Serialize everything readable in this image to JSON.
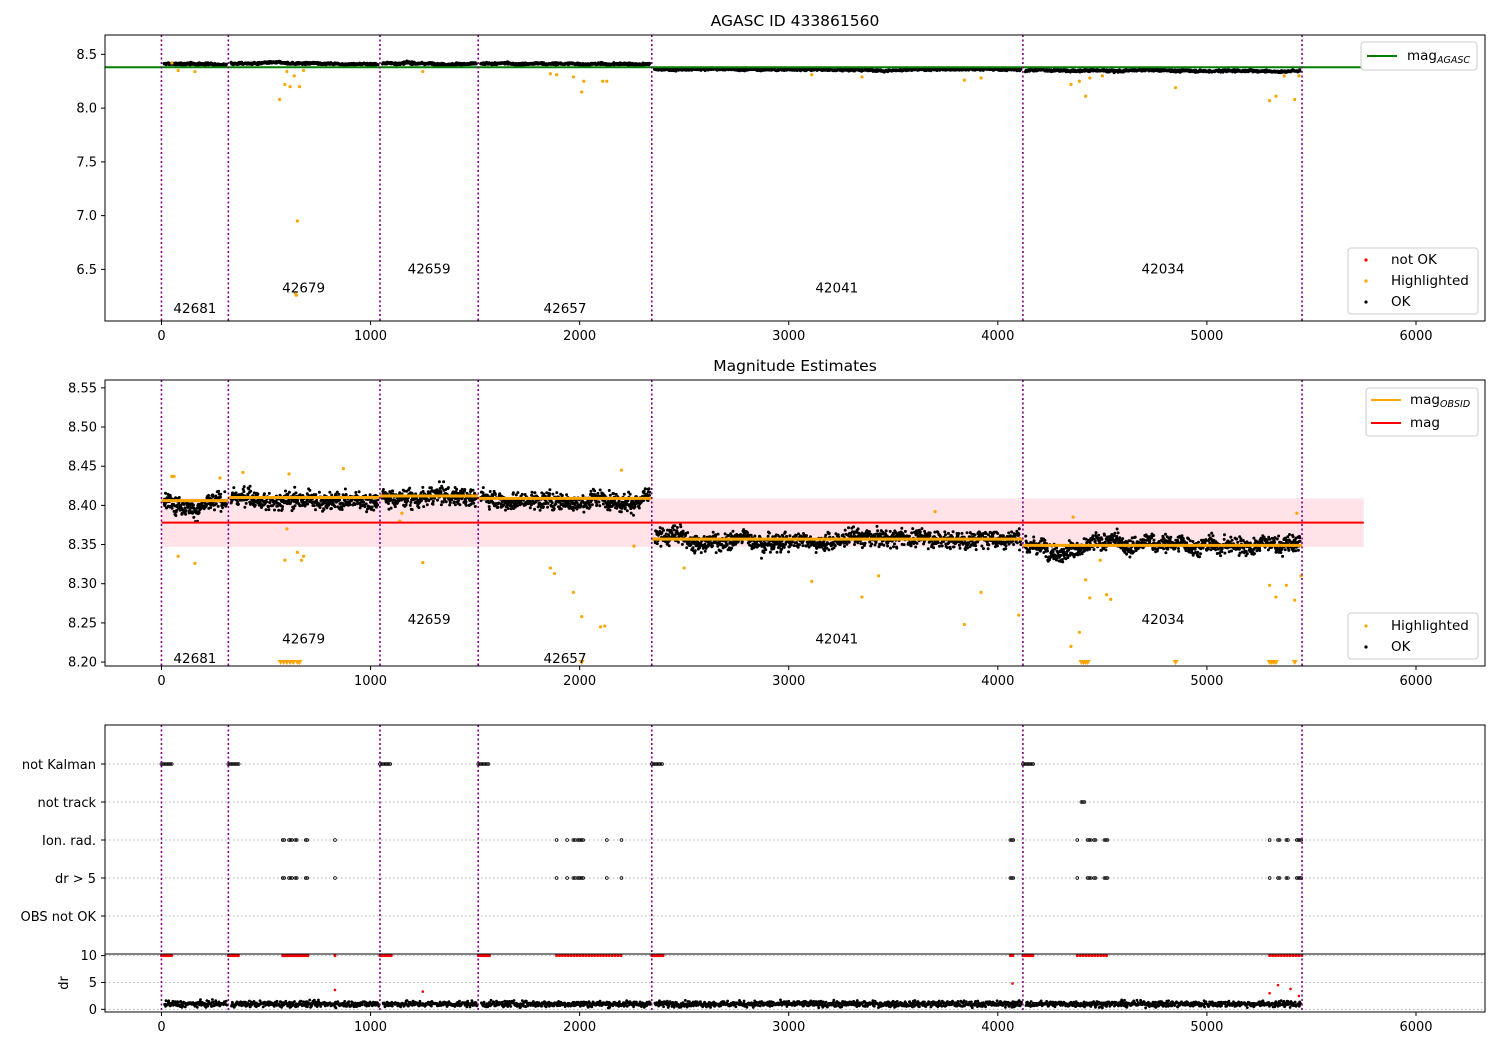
{
  "colors": {
    "ok": "#000000",
    "highlighted": "#ffa500",
    "not_ok": "#ff0000",
    "mag_agasc": "#008000",
    "mag_obsid": "#ffa500",
    "mag": "#ff0000",
    "mag_band": "#ffc0cb",
    "obsid_divider": "#800080"
  },
  "chart_data": [
    {
      "type": "scatter",
      "title": "AGASC ID 433861560",
      "xlabel": "",
      "ylabel": "",
      "xlim": [
        -270,
        6330
      ],
      "ylim": [
        6.02,
        8.68
      ],
      "x_ticks": [
        "0",
        "1000",
        "2000",
        "3000",
        "4000",
        "5000",
        "6000"
      ],
      "y_ticks": [
        "6.5",
        "7.0",
        "7.5",
        "8.0",
        "8.5"
      ],
      "grid": false,
      "obsid_boundaries": [
        0,
        320,
        1045,
        1515,
        2345,
        4120,
        5455
      ],
      "obsid_labels": [
        {
          "obsid": "42681",
          "x": 160,
          "y": 6.14
        },
        {
          "obsid": "42679",
          "x": 680,
          "y": 6.33
        },
        {
          "obsid": "42659",
          "x": 1280,
          "y": 6.51
        },
        {
          "obsid": "42657",
          "x": 1930,
          "y": 6.14
        },
        {
          "obsid": "42041",
          "x": 3230,
          "y": 6.33
        },
        {
          "obsid": "42034",
          "x": 4790,
          "y": 6.51
        }
      ],
      "mag_agasc": 8.38,
      "segments": [
        {
          "x_start": 0,
          "x_end": 320,
          "mean": 8.41,
          "spread": 0.012
        },
        {
          "x_start": 320,
          "x_end": 1045,
          "mean": 8.415,
          "spread": 0.012
        },
        {
          "x_start": 1045,
          "x_end": 1515,
          "mean": 8.415,
          "spread": 0.012
        },
        {
          "x_start": 1515,
          "x_end": 2345,
          "mean": 8.41,
          "spread": 0.012
        },
        {
          "x_start": 2345,
          "x_end": 4120,
          "mean": 8.36,
          "spread": 0.012
        },
        {
          "x_start": 4120,
          "x_end": 5455,
          "mean": 8.35,
          "spread": 0.012
        }
      ],
      "highlighted_points": [
        [
          50,
          8.42
        ],
        [
          80,
          8.35
        ],
        [
          160,
          8.34
        ],
        [
          565,
          8.08
        ],
        [
          590,
          8.22
        ],
        [
          600,
          8.34
        ],
        [
          615,
          8.2
        ],
        [
          635,
          8.3
        ],
        [
          640,
          6.28
        ],
        [
          645,
          6.26
        ],
        [
          650,
          6.95
        ],
        [
          660,
          8.2
        ],
        [
          680,
          8.35
        ],
        [
          1250,
          8.34
        ],
        [
          1860,
          8.32
        ],
        [
          1890,
          8.31
        ],
        [
          1970,
          8.29
        ],
        [
          2010,
          8.15
        ],
        [
          2020,
          8.25
        ],
        [
          2110,
          8.25
        ],
        [
          2130,
          8.25
        ],
        [
          3110,
          8.31
        ],
        [
          3350,
          8.29
        ],
        [
          3840,
          8.26
        ],
        [
          3920,
          8.28
        ],
        [
          4350,
          8.22
        ],
        [
          4390,
          8.25
        ],
        [
          4420,
          8.11
        ],
        [
          4440,
          8.28
        ],
        [
          4500,
          8.3
        ],
        [
          4850,
          8.19
        ],
        [
          5300,
          8.07
        ],
        [
          5330,
          8.11
        ],
        [
          5370,
          8.3
        ],
        [
          5420,
          8.08
        ],
        [
          5440,
          8.3
        ]
      ],
      "series": [
        {
          "name": "not OK",
          "marker": "dot"
        },
        {
          "name": "Highlighted",
          "marker": "dot"
        },
        {
          "name": "OK",
          "marker": "dot"
        }
      ],
      "legend_lines": [
        {
          "name": "mag",
          "subscript": "AGASC"
        }
      ],
      "legend_placement": "top-right (line), bottom-right (points)"
    },
    {
      "type": "scatter",
      "title": "Magnitude Estimates",
      "xlabel": "",
      "ylabel": "",
      "xlim": [
        -270,
        6330
      ],
      "ylim": [
        8.195,
        8.56
      ],
      "x_ticks": [
        "0",
        "1000",
        "2000",
        "3000",
        "4000",
        "5000",
        "6000"
      ],
      "y_ticks": [
        "8.20",
        "8.25",
        "8.30",
        "8.35",
        "8.40",
        "8.45",
        "8.50",
        "8.55"
      ],
      "grid": false,
      "obsid_labels": [
        {
          "obsid": "42681",
          "x": 160,
          "y": 8.205
        },
        {
          "obsid": "42679",
          "x": 680,
          "y": 8.23
        },
        {
          "obsid": "42659",
          "x": 1280,
          "y": 8.255
        },
        {
          "obsid": "42657",
          "x": 1930,
          "y": 8.205
        },
        {
          "obsid": "42041",
          "x": 3230,
          "y": 8.23
        },
        {
          "obsid": "42034",
          "x": 4790,
          "y": 8.255
        }
      ],
      "mag": 8.378,
      "mag_band": [
        8.347,
        8.409
      ],
      "mag_x_range": [
        0,
        5750
      ],
      "mag_obsid": [
        {
          "x_start": 0,
          "x_end": 320,
          "value": 8.406
        },
        {
          "x_start": 320,
          "x_end": 1045,
          "value": 8.41
        },
        {
          "x_start": 1045,
          "x_end": 1515,
          "value": 8.412
        },
        {
          "x_start": 1515,
          "x_end": 2345,
          "value": 8.409
        },
        {
          "x_start": 2345,
          "x_end": 4120,
          "value": 8.357
        },
        {
          "x_start": 4120,
          "x_end": 5455,
          "value": 8.349
        }
      ],
      "segments": [
        {
          "x_start": 0,
          "x_end": 320,
          "mean": 8.403,
          "spread": 0.012
        },
        {
          "x_start": 320,
          "x_end": 1045,
          "mean": 8.41,
          "spread": 0.013
        },
        {
          "x_start": 1045,
          "x_end": 1515,
          "mean": 8.412,
          "spread": 0.012
        },
        {
          "x_start": 1515,
          "x_end": 2345,
          "mean": 8.41,
          "spread": 0.012
        },
        {
          "x_start": 2345,
          "x_end": 4120,
          "mean": 8.358,
          "spread": 0.012
        },
        {
          "x_start": 4120,
          "x_end": 5455,
          "mean": 8.349,
          "spread": 0.012
        }
      ],
      "highlighted_points": [
        [
          50,
          8.437
        ],
        [
          60,
          8.437
        ],
        [
          80,
          8.335
        ],
        [
          160,
          8.326
        ],
        [
          280,
          8.435
        ],
        [
          390,
          8.442
        ],
        [
          590,
          8.33
        ],
        [
          600,
          8.37
        ],
        [
          610,
          8.44
        ],
        [
          650,
          8.34
        ],
        [
          670,
          8.33
        ],
        [
          680,
          8.335
        ],
        [
          870,
          8.447
        ],
        [
          1140,
          8.38
        ],
        [
          1150,
          8.39
        ],
        [
          1250,
          8.327
        ],
        [
          1860,
          8.32
        ],
        [
          1880,
          8.313
        ],
        [
          1970,
          8.289
        ],
        [
          2010,
          8.258
        ],
        [
          2100,
          8.245
        ],
        [
          2120,
          8.246
        ],
        [
          2200,
          8.445
        ],
        [
          2260,
          8.348
        ],
        [
          2500,
          8.32
        ],
        [
          3110,
          8.303
        ],
        [
          3350,
          8.283
        ],
        [
          3430,
          8.31
        ],
        [
          3700,
          8.392
        ],
        [
          3840,
          8.248
        ],
        [
          3920,
          8.289
        ],
        [
          4100,
          8.26
        ],
        [
          4350,
          8.22
        ],
        [
          4360,
          8.385
        ],
        [
          4390,
          8.238
        ],
        [
          4420,
          8.305
        ],
        [
          4440,
          8.282
        ],
        [
          4490,
          8.33
        ],
        [
          4520,
          8.286
        ],
        [
          4540,
          8.28
        ],
        [
          5300,
          8.298
        ],
        [
          5330,
          8.283
        ],
        [
          5380,
          8.298
        ],
        [
          5420,
          8.279
        ],
        [
          5430,
          8.39
        ],
        [
          5450,
          8.31
        ]
      ],
      "floor_markers": [
        570,
        585,
        600,
        615,
        630,
        650,
        660,
        2010,
        4400,
        4410,
        4420,
        4430,
        4850,
        5300,
        5310,
        5320,
        5330,
        5420
      ],
      "series": [
        {
          "name": "Highlighted",
          "marker": "dot"
        },
        {
          "name": "OK",
          "marker": "dot"
        }
      ],
      "legend_lines": [
        {
          "name": "mag",
          "subscript": "OBSID"
        },
        {
          "name": "mag",
          "subscript": ""
        }
      ],
      "legend_placement": "top-right (lines), bottom-right (points)"
    },
    {
      "type": "scatter",
      "title": "",
      "xlabel": "",
      "ylabel": "",
      "xlim": [
        -270,
        6330
      ],
      "categories": [
        "not Kalman",
        "not track",
        "Ion. rad.",
        "dr > 5",
        "OBS not OK"
      ],
      "grid": true,
      "flags": {
        "not Kalman": [
          [
            0,
            50
          ],
          [
            320,
            370
          ],
          [
            1045,
            1100
          ],
          [
            1515,
            1570
          ],
          [
            2345,
            2400
          ],
          [
            4120,
            4170
          ]
        ],
        "not track": [
          [
            4400,
            4420
          ]
        ],
        "Ion. rad.": [
          [
            580,
            590
          ],
          [
            610,
            625
          ],
          [
            640,
            650
          ],
          [
            690,
            700
          ],
          [
            830,
            835
          ],
          [
            1890,
            1895
          ],
          [
            1940,
            1945
          ],
          [
            1970,
            1980
          ],
          [
            1990,
            2005
          ],
          [
            2010,
            2020
          ],
          [
            2130,
            2135
          ],
          [
            2200,
            2205
          ],
          [
            4060,
            4075
          ],
          [
            4380,
            4385
          ],
          [
            4430,
            4445
          ],
          [
            4460,
            4470
          ],
          [
            4510,
            4525
          ],
          [
            5300,
            5305
          ],
          [
            5340,
            5350
          ],
          [
            5380,
            5390
          ],
          [
            5430,
            5455
          ]
        ],
        "dr > 5": [
          [
            580,
            590
          ],
          [
            610,
            625
          ],
          [
            640,
            650
          ],
          [
            690,
            700
          ],
          [
            830,
            835
          ],
          [
            1890,
            1895
          ],
          [
            1940,
            1945
          ],
          [
            1970,
            1980
          ],
          [
            1990,
            2005
          ],
          [
            2010,
            2020
          ],
          [
            2130,
            2135
          ],
          [
            2200,
            2205
          ],
          [
            4060,
            4075
          ],
          [
            4380,
            4385
          ],
          [
            4430,
            4445
          ],
          [
            4460,
            4470
          ],
          [
            4510,
            4525
          ],
          [
            5300,
            5305
          ],
          [
            5340,
            5350
          ],
          [
            5380,
            5390
          ],
          [
            5430,
            5455
          ]
        ],
        "OBS not OK": []
      }
    },
    {
      "type": "scatter",
      "title": "",
      "xlabel": "",
      "ylabel": "dr",
      "xlim": [
        -270,
        6330
      ],
      "ylim": [
        -0.5,
        10.3
      ],
      "x_ticks": [
        "0",
        "1000",
        "2000",
        "3000",
        "4000",
        "5000",
        "6000"
      ],
      "y_ticks": [
        "0",
        "5",
        "10"
      ],
      "grid": true,
      "typical_dr": 1.0,
      "not_ok_points_at_10": [
        [
          0,
          50
        ],
        [
          320,
          370
        ],
        [
          1045,
          1100
        ],
        [
          1515,
          1570
        ],
        [
          2345,
          2400
        ],
        [
          4120,
          4170
        ],
        [
          580,
          700
        ],
        [
          830,
          835
        ],
        [
          1890,
          2210
        ],
        [
          4060,
          4075
        ],
        [
          4380,
          4525
        ],
        [
          5300,
          5455
        ]
      ],
      "scattered_not_ok": [
        [
          830,
          3.6
        ],
        [
          1250,
          3.3
        ],
        [
          4070,
          4.8
        ],
        [
          5300,
          3.0
        ],
        [
          5340,
          4.5
        ],
        [
          5400,
          3.8
        ],
        [
          5440,
          2.5
        ]
      ]
    }
  ]
}
